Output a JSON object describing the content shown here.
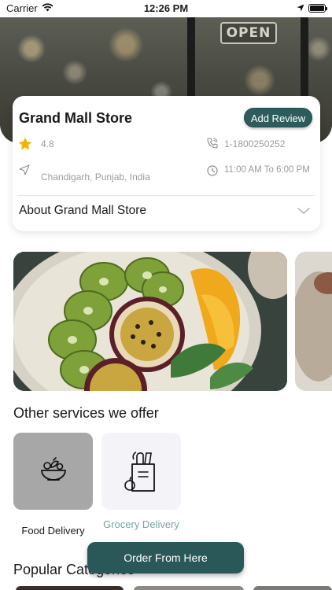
{
  "status_bar": {
    "carrier": "Carrier",
    "time": "12:26 PM"
  },
  "hero": {
    "sign_text": "OPEN"
  },
  "store": {
    "name": "Grand Mall Store",
    "add_review_label": "Add Review",
    "rating": "4.8",
    "phone": "1-1800250252",
    "address": "Chandigarh, Punjab, India",
    "hours": "11:00 AM To 6:00 PM",
    "about_label": "About Grand Mall Store"
  },
  "services": {
    "title": "Other services we offer",
    "items": [
      {
        "label": "Food Delivery",
        "icon": "food-bowl-icon"
      },
      {
        "label": "Grocery Delivery",
        "icon": "grocery-bag-icon"
      }
    ]
  },
  "popular": {
    "title": "Popular Categories"
  },
  "order_button": {
    "label": "Order From Here"
  },
  "colors": {
    "accent": "#2a5757",
    "star": "#f3b400",
    "muted_text": "#9a9a9a",
    "grocery_label": "#7aa1a1"
  }
}
